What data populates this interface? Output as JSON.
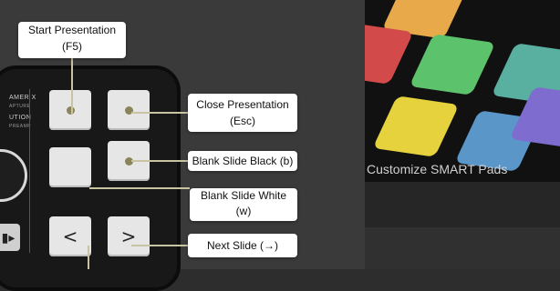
{
  "callouts": {
    "start_presentation": "Start Presentation",
    "start_shortcut": "(F5)",
    "close_presentation": "Close Presentation",
    "close_shortcut": "(Esc)",
    "blank_black": "Blank Slide Black (b)",
    "blank_white": "Blank Slide White",
    "blank_white_shortcut": "(w)",
    "next_slide": "Next Slide (→)"
  },
  "device": {
    "brand_line1": "AMER X",
    "brand_line2": "APTURE",
    "brand_line3": "UTION",
    "brand_line4": "PREAMP",
    "prev_glyph": "<",
    "next_glyph": ">",
    "camera_icon": "camera-icon"
  },
  "right_panel": {
    "caption": "Customize SMART Pads"
  },
  "colors": {
    "callout_bg": "#ffffff",
    "connector": "#c8c3a0",
    "pad": "#e6e6e6"
  }
}
